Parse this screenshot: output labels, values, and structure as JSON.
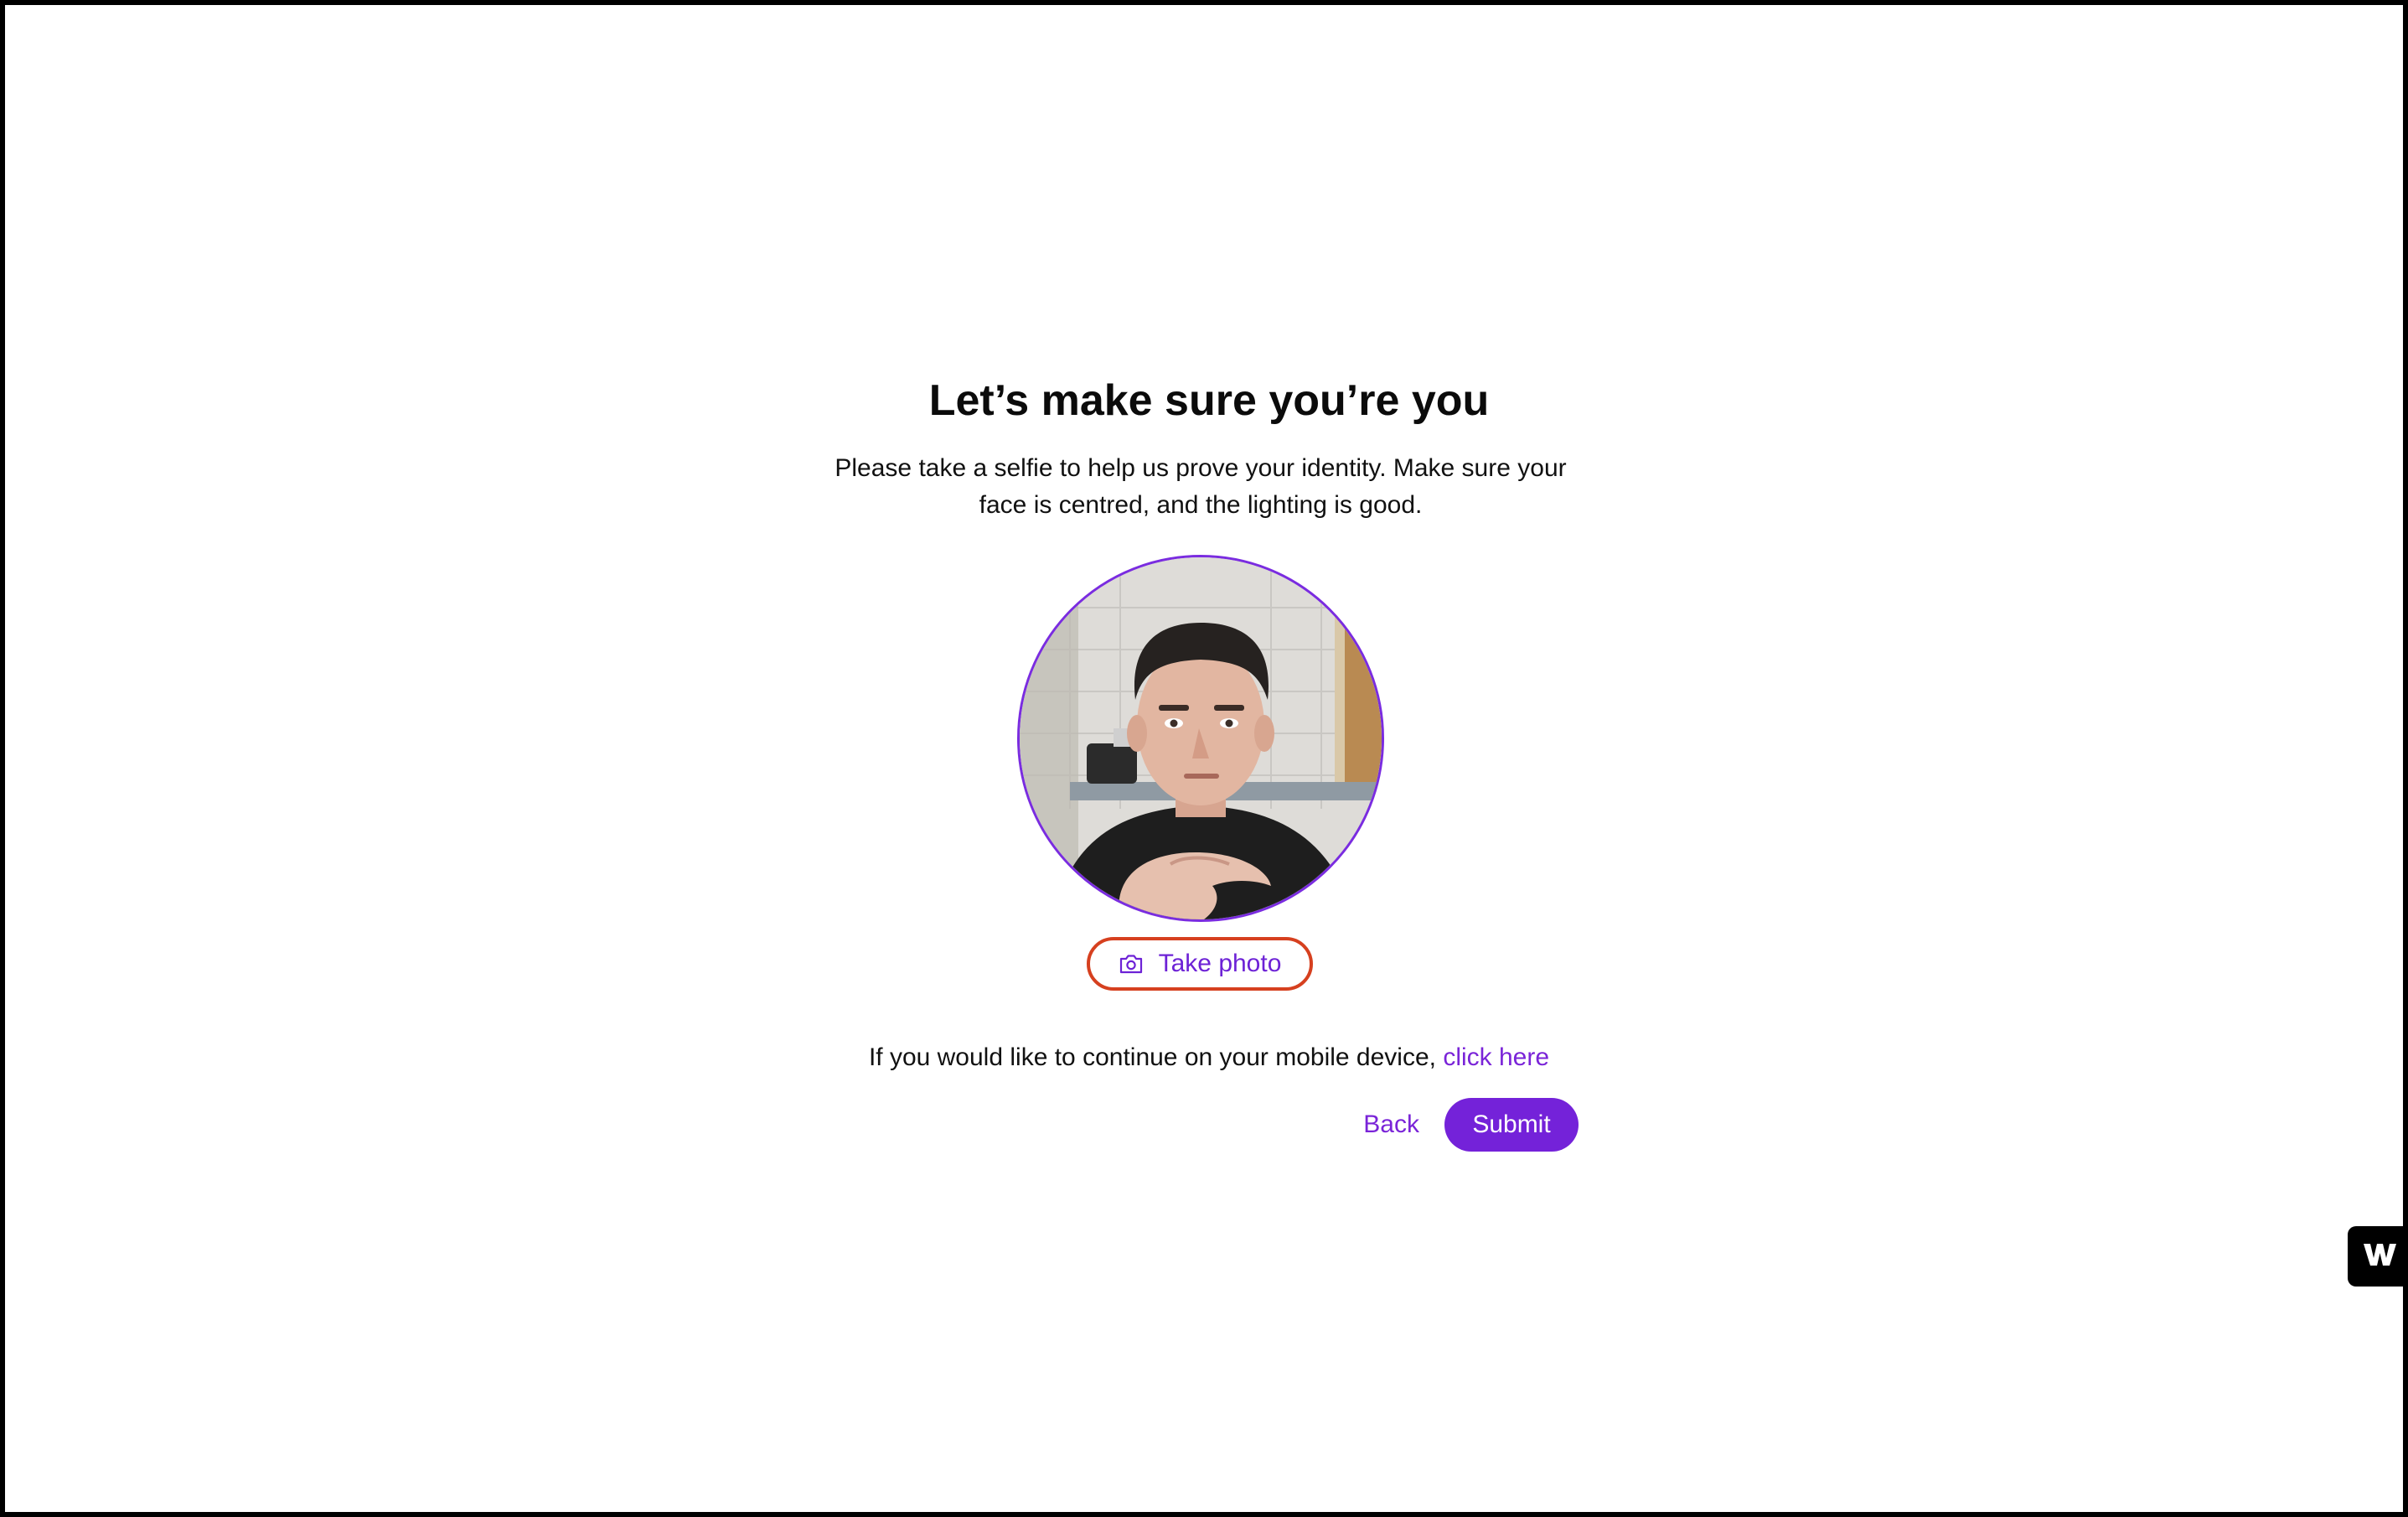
{
  "page": {
    "title": "Let’s make sure you’re you",
    "description_line1": "Please take a selfie to help us prove your identity. Make sure your",
    "description_line2": "face is centred, and the lighting is good."
  },
  "camera": {
    "preview_alt": "Selfie camera preview",
    "take_photo_label": "Take photo",
    "take_photo_icon": "camera-icon"
  },
  "mobile": {
    "prompt": "If you would like to continue on your mobile device, ",
    "link_label": "click here"
  },
  "actions": {
    "back_label": "Back",
    "submit_label": "Submit"
  },
  "widget": {
    "icon": "w-logo-icon"
  },
  "colors": {
    "accent": "#7422d9",
    "link": "#7a24d8",
    "focus_ring": "#d6401f",
    "frame_border": "#000000",
    "background": "#ffffff"
  }
}
